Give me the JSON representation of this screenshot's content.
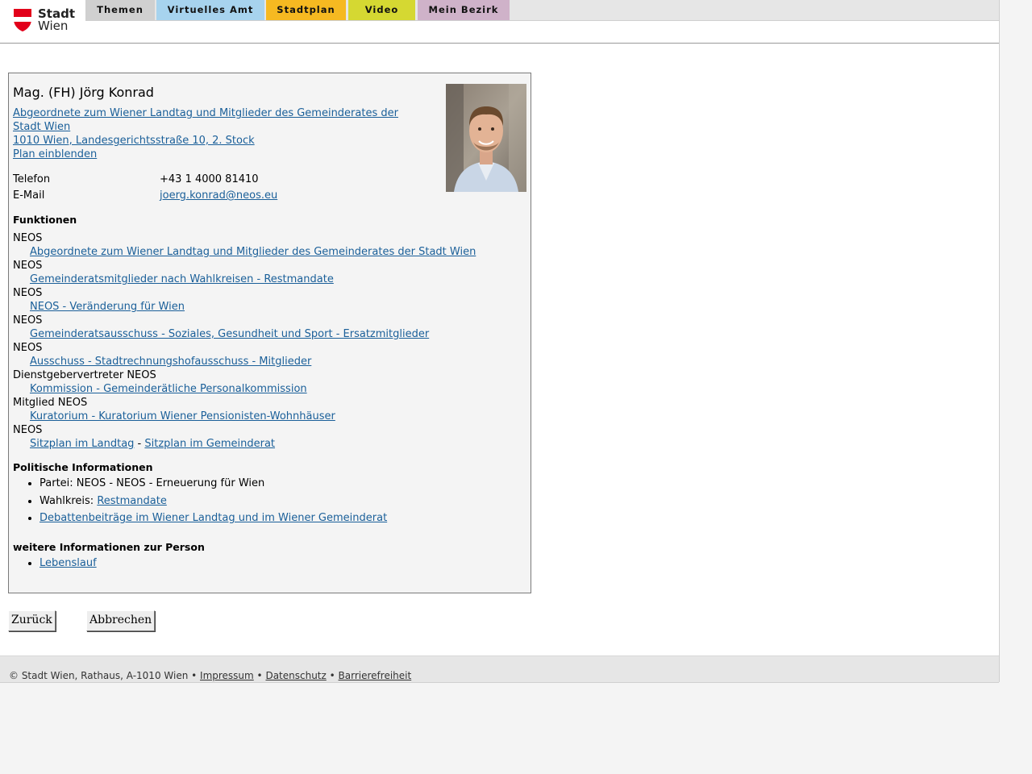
{
  "brand": {
    "line1": "Stadt",
    "line2": "Wien"
  },
  "nav": {
    "tabs": [
      {
        "label": "Themen",
        "color": "#d0d0d0"
      },
      {
        "label": "Virtuelles Amt",
        "color": "#a7d3ee"
      },
      {
        "label": "Stadtplan",
        "color": "#f6b921"
      },
      {
        "label": "Video",
        "color": "#d5d832"
      },
      {
        "label": "Mein Bezirk",
        "color": "#cfb2c9"
      }
    ]
  },
  "person": {
    "name": "Mag. (FH) Jörg Konrad",
    "org_link_line1": "Abgeordnete zum Wiener Landtag und Mitglieder des Gemeinderates der",
    "org_link_line2": "Stadt Wien ",
    "address_link": "1010 Wien, Landesgerichtsstraße 10, 2. Stock",
    "plan_link": "Plan einblenden",
    "phone_label": "Telefon",
    "phone_value": "+43 1 4000 81410",
    "email_label": "E-Mail",
    "email_value": "joerg.konrad@neos.eu"
  },
  "functions": {
    "heading": "Funktionen",
    "items": [
      {
        "role": "NEOS",
        "link": "Abgeordnete zum Wiener Landtag und Mitglieder des Gemeinderates der Stadt Wien"
      },
      {
        "role": "NEOS",
        "link": "Gemeinderatsmitglieder nach Wahlkreisen - Restmandate"
      },
      {
        "role": "NEOS",
        "link": "NEOS - Veränderung für Wien"
      },
      {
        "role": "NEOS",
        "link": "Gemeinderatsausschuss - Soziales, Gesundheit und Sport - Ersatzmitglieder"
      },
      {
        "role": "NEOS",
        "link": "Ausschuss - Stadtrechnungshofausschuss - Mitglieder"
      },
      {
        "role": "Dienstgebervertreter NEOS",
        "link": "Kommission - Gemeinderätliche Personalkommission"
      },
      {
        "role": "Mitglied NEOS",
        "link": "Kuratorium - Kuratorium Wiener Pensionisten-Wohnhäuser"
      }
    ],
    "last_role": "NEOS",
    "seating_link_1": "Sitzplan im Landtag",
    "seating_separator": " - ",
    "seating_link_2": "Sitzplan im Gemeinderat"
  },
  "political": {
    "heading": "Politische Informationen",
    "party_text": "Partei: NEOS - NEOS - Erneuerung für Wien",
    "district_label": "Wahlkreis: ",
    "district_link": "Restmandate",
    "debates_link": "Debattenbeiträge im Wiener Landtag und im Wiener Gemeinderat"
  },
  "more_info": {
    "heading": "weitere Informationen zur Person",
    "cv_link": "Lebenslauf"
  },
  "buttons": {
    "back": "Zurück",
    "cancel": "Abbrechen"
  },
  "footer": {
    "copyright": "© Stadt Wien, Rathaus, A-1010 Wien",
    "sep": " • ",
    "imprint": "Impressum",
    "privacy": "Datenschutz",
    "accessibility": "Barrierefreiheit"
  }
}
